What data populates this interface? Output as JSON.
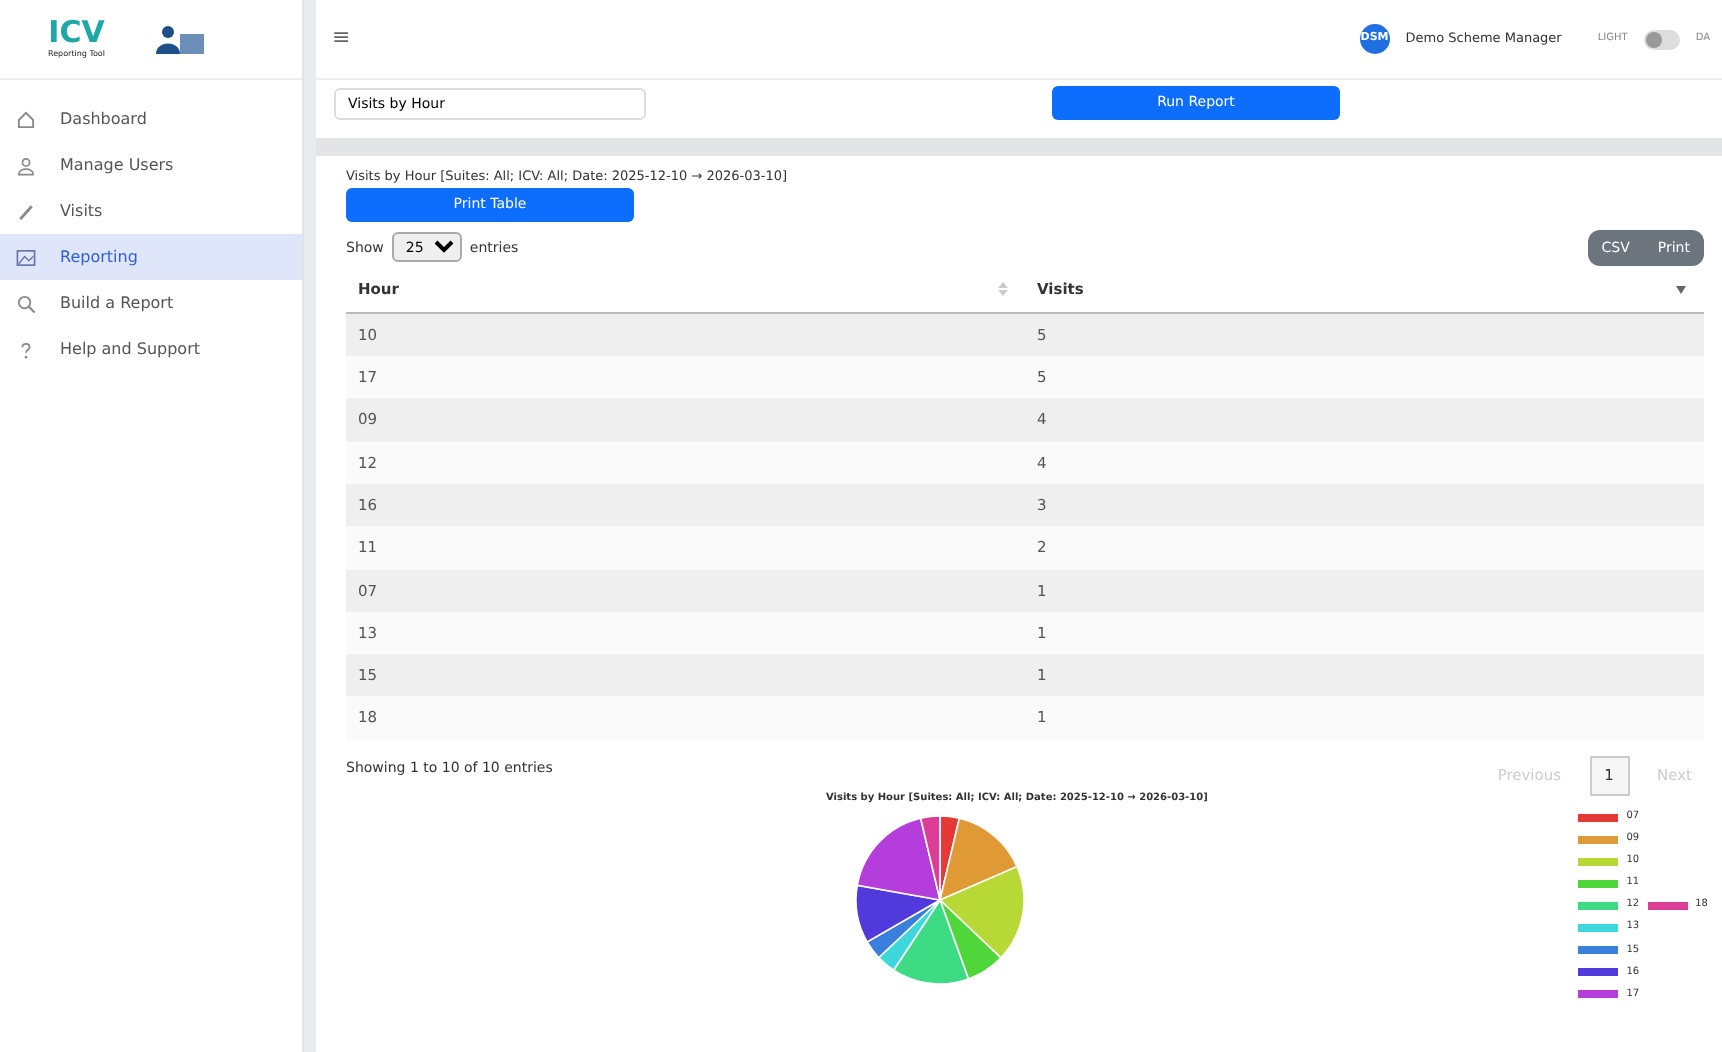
{
  "sidebar": {
    "logo": {
      "title": "ICV",
      "subtitle": "Reporting Tool"
    },
    "items": [
      {
        "label": "Dashboard",
        "selected": false
      },
      {
        "label": "Manage Users",
        "selected": false
      },
      {
        "label": "Visits",
        "selected": false
      },
      {
        "label": "Reporting",
        "selected": true
      },
      {
        "label": "Build a Report",
        "selected": false
      },
      {
        "label": "Help and Support",
        "selected": false
      }
    ]
  },
  "topbar": {
    "menu_glyph": "≡",
    "avatar": "DSM",
    "user": "Demo Scheme Manager",
    "theme_light": "LIGHT",
    "theme_dark": "DA",
    "dark_mode": false
  },
  "report_form": {
    "report": "Visits by Hour",
    "run_button": "Run Report"
  },
  "report": {
    "title": "Visits by Hour [Suites: All; ICV: All; Date: 2025-12-10 → 2026-03-10]",
    "print_button": "Print Table",
    "length": {
      "before": "Show",
      "value": "25",
      "after": "entries"
    },
    "export_buttons": [
      "CSV",
      "Print"
    ],
    "table": {
      "columns": [
        "Hour",
        "Visits"
      ],
      "rows": [
        [
          "10",
          "5"
        ],
        [
          "17",
          "5"
        ],
        [
          "09",
          "4"
        ],
        [
          "12",
          "4"
        ],
        [
          "16",
          "3"
        ],
        [
          "11",
          "2"
        ],
        [
          "07",
          "1"
        ],
        [
          "13",
          "1"
        ],
        [
          "15",
          "1"
        ],
        [
          "18",
          "1"
        ]
      ]
    },
    "info": "Showing 1 to 10 of 10 entries",
    "pagination": [
      {
        "label": "Previous",
        "kind": "prev",
        "disabled": true
      },
      {
        "label": "1",
        "kind": "page",
        "selected": true
      },
      {
        "label": "Next",
        "kind": "next",
        "disabled": true
      }
    ],
    "chart": {
      "chart_data": {
        "type": "pie",
        "title": "Visits by Hour [Suites: All; ICV: All; Date: 2025-12-10 → 2026-03-10]",
        "categories": [
          "07",
          "09",
          "10",
          "11",
          "12",
          "13",
          "15",
          "16",
          "17",
          "18"
        ],
        "series": [
          {
            "values": [
              3.7,
              14.8,
              18.6,
              7.4,
              14.8,
              3.7,
              3.7,
              11.1,
              18.5,
              3.7
            ]
          }
        ]
      },
      "legend": [
        {
          "color": "#e53935"
        },
        {
          "color": "#e09a35"
        },
        {
          "color": "#b8d935"
        },
        {
          "color": "#4ed63a"
        },
        {
          "color": "#3ddc84"
        },
        {
          "color": "#3dd8dc"
        },
        {
          "color": "#3a7fdc"
        },
        {
          "color": "#5239dc"
        },
        {
          "color": "#b43ddc"
        },
        {
          "color": "#dc3d96"
        }
      ]
    }
  }
}
